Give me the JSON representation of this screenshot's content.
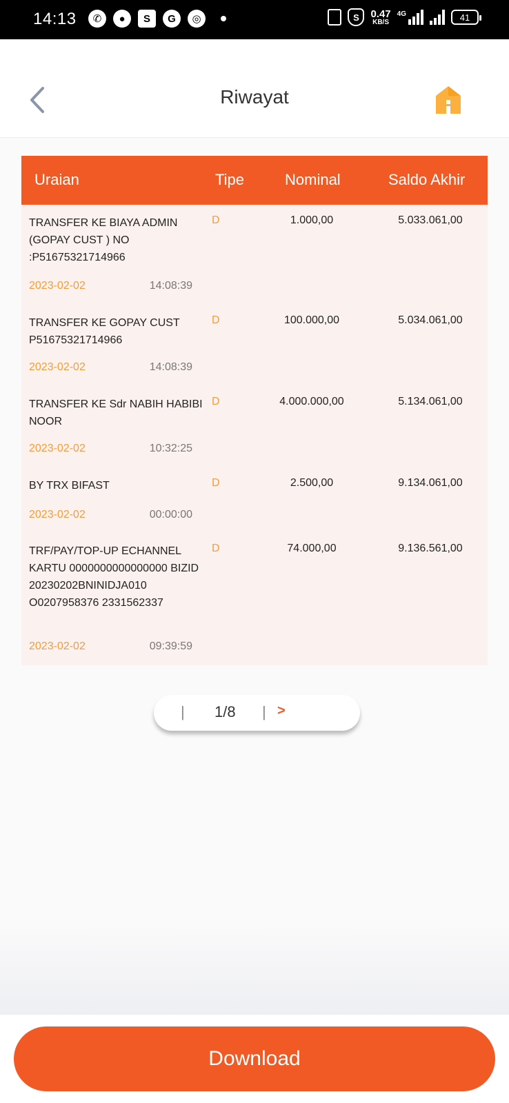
{
  "status_bar": {
    "time": "14:13",
    "speed_value": "0.47",
    "speed_unit": "KB/S",
    "network": "4G",
    "battery": "41"
  },
  "header": {
    "title": "Riwayat"
  },
  "table": {
    "columns": [
      "Uraian",
      "Tipe",
      "Nominal",
      "Saldo Akhir"
    ],
    "rows": [
      {
        "desc": "TRANSFER KE BIAYA ADMIN (GOPAY CUST ) NO :P51675321714966",
        "tipe": "D",
        "nominal": "1.000,00",
        "saldo": "5.033.061,00",
        "date": "2023-02-02",
        "time": "14:08:39"
      },
      {
        "desc": "TRANSFER KE GOPAY CUST P51675321714966",
        "tipe": "D",
        "nominal": "100.000,00",
        "saldo": "5.034.061,00",
        "date": "2023-02-02",
        "time": "14:08:39"
      },
      {
        "desc": "TRANSFER KE Sdr NABIH HABIBI NOOR",
        "tipe": "D",
        "nominal": "4.000.000,00",
        "saldo": "5.134.061,00",
        "date": "2023-02-02",
        "time": "10:32:25"
      },
      {
        "desc": "BY TRX BIFAST",
        "tipe": "D",
        "nominal": "2.500,00",
        "saldo": "9.134.061,00",
        "date": "2023-02-02",
        "time": "00:00:00"
      },
      {
        "desc": "TRF/PAY/TOP-UP ECHANNEL KARTU 0000000000000000 BIZID 20230202BNINIDJA010 O0207958376 2331562337",
        "tipe": "D",
        "nominal": "74.000,00",
        "saldo": "9.136.561,00",
        "date": "2023-02-02",
        "time": "09:39:59"
      }
    ]
  },
  "pagination": {
    "page": "1/8",
    "separator": "|",
    "next_label": ">"
  },
  "download_label": "Download",
  "colors": {
    "accent": "#f15a24",
    "date_orange": "#f39c3d",
    "row_bg": "#fbf2ef"
  }
}
